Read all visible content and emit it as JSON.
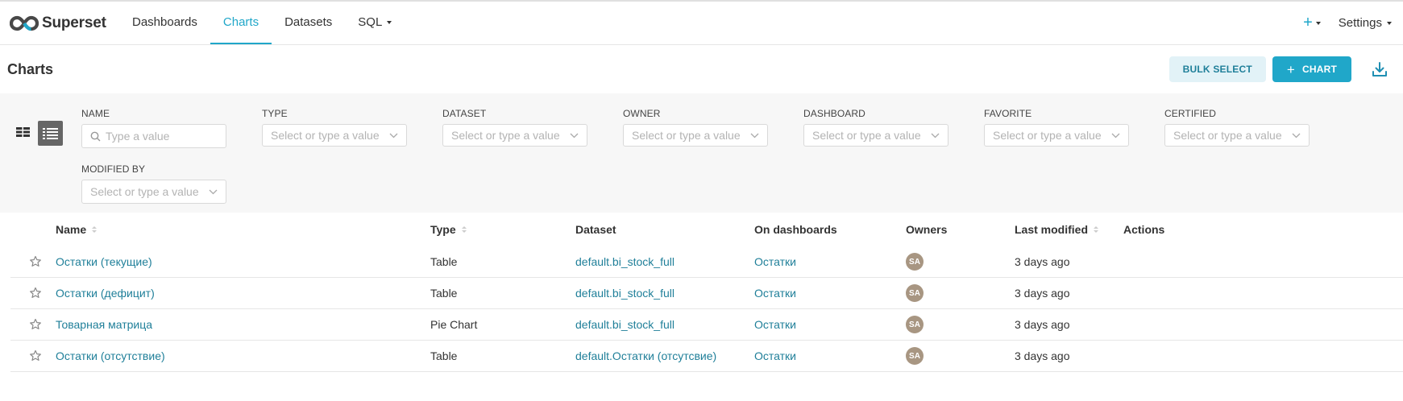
{
  "brand": {
    "name": "Superset"
  },
  "nav": {
    "items": [
      {
        "label": "Dashboards"
      },
      {
        "label": "Charts"
      },
      {
        "label": "Datasets"
      },
      {
        "label": "SQL"
      }
    ],
    "plus_label": "+",
    "settings_label": "Settings"
  },
  "header": {
    "title": "Charts",
    "bulk_select": "BULK SELECT",
    "add_chart": "CHART",
    "add_chart_icon": "+"
  },
  "filters": [
    {
      "label": "NAME",
      "placeholder": "Type a value"
    },
    {
      "label": "TYPE",
      "placeholder": "Select or type a value"
    },
    {
      "label": "DATASET",
      "placeholder": "Select or type a value"
    },
    {
      "label": "OWNER",
      "placeholder": "Select or type a value"
    },
    {
      "label": "DASHBOARD",
      "placeholder": "Select or type a value"
    },
    {
      "label": "FAVORITE",
      "placeholder": "Select or type a value"
    },
    {
      "label": "CERTIFIED",
      "placeholder": "Select or type a value"
    },
    {
      "label": "MODIFIED BY",
      "placeholder": "Select or type a value"
    }
  ],
  "table": {
    "columns": [
      "Name",
      "Type",
      "Dataset",
      "On dashboards",
      "Owners",
      "Last modified",
      "Actions"
    ],
    "rows": [
      {
        "name": "Остатки (текущие)",
        "type": "Table",
        "dataset": "default.bi_stock_full",
        "dashboard": "Остатки",
        "owner": "SA",
        "modified": "3 days ago"
      },
      {
        "name": "Остатки (дефицит)",
        "type": "Table",
        "dataset": "default.bi_stock_full",
        "dashboard": "Остатки",
        "owner": "SA",
        "modified": "3 days ago"
      },
      {
        "name": "Товарная матрица",
        "type": "Pie Chart",
        "dataset": "default.bi_stock_full",
        "dashboard": "Остатки",
        "owner": "SA",
        "modified": "3 days ago"
      },
      {
        "name": "Остатки (отсутствие)",
        "type": "Table",
        "dataset": "default.Остатки (отсутсвие)",
        "dashboard": "Остатки",
        "owner": "SA",
        "modified": "3 days ago"
      }
    ]
  },
  "colors": {
    "accent": "#20a7c9",
    "link": "#1f7f99",
    "avatar": "#a89682"
  },
  "icons": [
    "superset-logo-icon",
    "caret-down-icon",
    "download-icon",
    "card-view-icon",
    "list-view-icon",
    "search-icon",
    "chevron-down-icon",
    "star-icon",
    "sort-icon"
  ]
}
